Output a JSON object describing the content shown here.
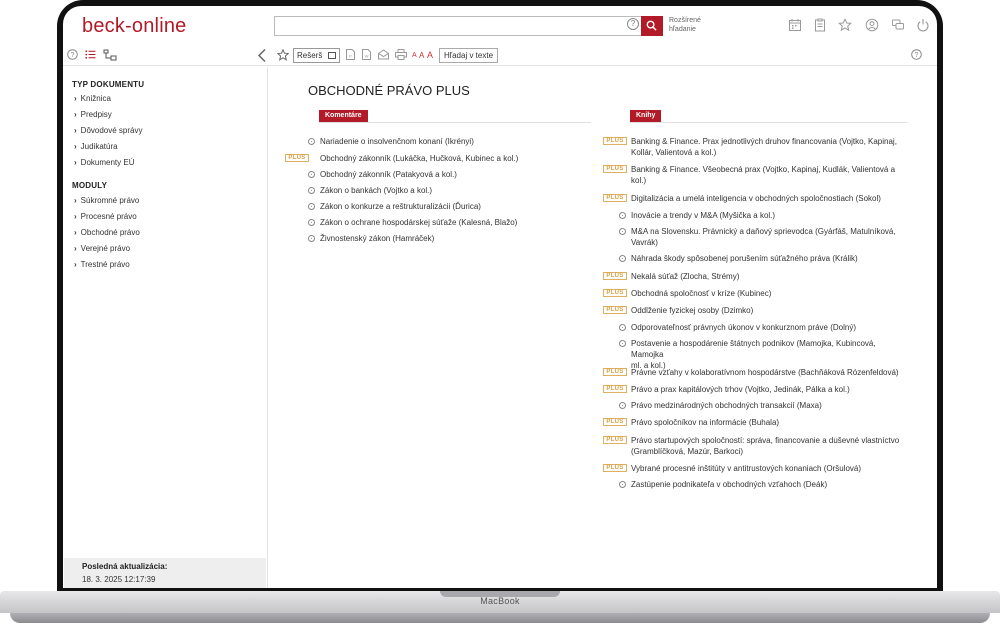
{
  "device": {
    "label": "MacBook"
  },
  "header": {
    "logo": "beck-online",
    "search": {
      "placeholder": "",
      "help": "?"
    },
    "advanced_search": [
      "Rozšírené",
      "hľadanie"
    ]
  },
  "toolbar": {
    "research_label": "Rešerš",
    "font_sizes": [
      "A",
      "A",
      "A"
    ],
    "search_in_text": "Hľadaj v texte"
  },
  "sidebar": {
    "doc_type_heading": "TYP DOKUMENTU",
    "doc_types": [
      "Knižnica",
      "Predpisy",
      "Dôvodové správy",
      "Judikatúra",
      "Dokumenty EÚ"
    ],
    "modules_heading": "MODULY",
    "modules": [
      "Súkromné právo",
      "Procesné právo",
      "Obchodné právo",
      "Verejné právo",
      "Trestné právo"
    ],
    "update_title": "Posledná aktualizácia:",
    "update_date": "18. 3. 2025 12:17:39"
  },
  "main": {
    "title": "OBCHODNÉ PRÁVO PLUS",
    "plus_badge": "PLUS",
    "commentaries": {
      "label": "Komentáre",
      "items": [
        {
          "text": "Nariadenie o insolvenčnom konaní (Ikrényi)",
          "plus": false
        },
        {
          "text": "Obchodný zákonník (Lukáčka, Hučková, Kubinec a kol.)",
          "plus": true
        },
        {
          "text": "Obchodný zákonník (Patakyová a kol.)",
          "plus": false
        },
        {
          "text": "Zákon o bankách (Vojtko a kol.)",
          "plus": false
        },
        {
          "text": "Zákon o konkurze a reštrukturalizácii (Ďurica)",
          "plus": false
        },
        {
          "text": "Zákon o ochrane hospodárskej súťaže (Kalesná, Blažo)",
          "plus": false
        },
        {
          "text": "Živnostenský zákon (Hamráček)",
          "plus": false
        }
      ]
    },
    "books": {
      "label": "Knihy",
      "items": [
        {
          "lines": [
            "Banking & Finance. Prax jednotlivých druhov financovania (Vojtko, Kapinaj,",
            "Kollár, Valientová a kol.)"
          ],
          "plus": true
        },
        {
          "lines": [
            "Banking & Finance. Všeobecná prax (Vojtko, Kapinaj, Kudlák, Valientová a",
            "kol.)"
          ],
          "plus": true
        },
        {
          "lines": [
            "Digitalizácia a umelá inteligencia v obchodných spoločnostiach (Sokol)"
          ],
          "plus": true
        },
        {
          "lines": [
            "Inovácie a trendy v M&A (Myšička a kol.)"
          ],
          "plus": false
        },
        {
          "lines": [
            "M&A na Slovensku. Právnický a daňový sprievodca (Gyárfáš, Matulníková,",
            "Vavrák)"
          ],
          "plus": false
        },
        {
          "lines": [
            "Náhrada škody spôsobenej porušením súťažného práva (Králik)"
          ],
          "plus": false
        },
        {
          "lines": [
            "Nekalá súťaž (Zlocha, Strémy)"
          ],
          "plus": true
        },
        {
          "lines": [
            "Obchodná spoločnosť v kríze (Kubinec)"
          ],
          "plus": true
        },
        {
          "lines": [
            "Oddlženie fyzickej osoby (Dzimko)"
          ],
          "plus": true
        },
        {
          "lines": [
            "Odporovateľnosť právnych úkonov v konkurznom práve (Dolný)"
          ],
          "plus": false
        },
        {
          "lines": [
            "Postavenie a hospodárenie štátnych podnikov (Mamojka, Kubincová, Mamojka",
            "ml. a kol.)"
          ],
          "plus": false
        },
        {
          "lines": [
            "Právne vzťahy v kolaboratívnom hospodárstve (Bachňáková Rózenfeldová)"
          ],
          "plus": true
        },
        {
          "lines": [
            "Právo a prax kapitálových trhov (Vojtko, Jedinák, Pálka a kol.)"
          ],
          "plus": true
        },
        {
          "lines": [
            "Právo medzinárodných obchodných transakcií (Maxa)"
          ],
          "plus": false
        },
        {
          "lines": [
            "Právo spoločníkov na informácie (Buhala)"
          ],
          "plus": true
        },
        {
          "lines": [
            "Právo startupových spoločností: správa, financovanie a duševné vlastníctvo",
            "(Gramblíčková, Mazúr, Barkoci)"
          ],
          "plus": true
        },
        {
          "lines": [
            "Vybrané procesné inštitúty v antitrustových konaniach (Oršulová)"
          ],
          "plus": true
        },
        {
          "lines": [
            "Zastúpenie podnikateľa v obchodných vzťahoch (Deák)"
          ],
          "plus": false
        }
      ]
    }
  }
}
